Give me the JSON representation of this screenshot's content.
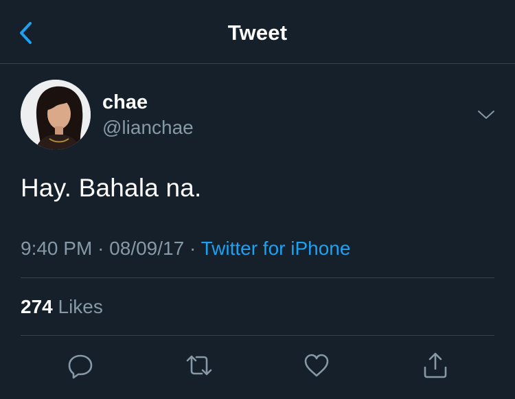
{
  "nav": {
    "title": "Tweet",
    "back_icon": "chevron-left-icon"
  },
  "tweet": {
    "author": {
      "display_name": "chae",
      "handle": "@lianchae"
    },
    "text": "Hay. Bahala na.",
    "time": "9:40 PM",
    "date": "08/09/17",
    "source": "Twitter for iPhone",
    "separator": "·",
    "likes": {
      "count": "274",
      "label": "Likes"
    }
  },
  "actions": [
    {
      "icon": "reply-icon"
    },
    {
      "icon": "retweet-icon"
    },
    {
      "icon": "like-icon"
    },
    {
      "icon": "share-icon"
    }
  ],
  "colors": {
    "background": "#15202b",
    "accent": "#1da1f2",
    "muted_text": "#8899a6",
    "divider": "#38444d"
  }
}
